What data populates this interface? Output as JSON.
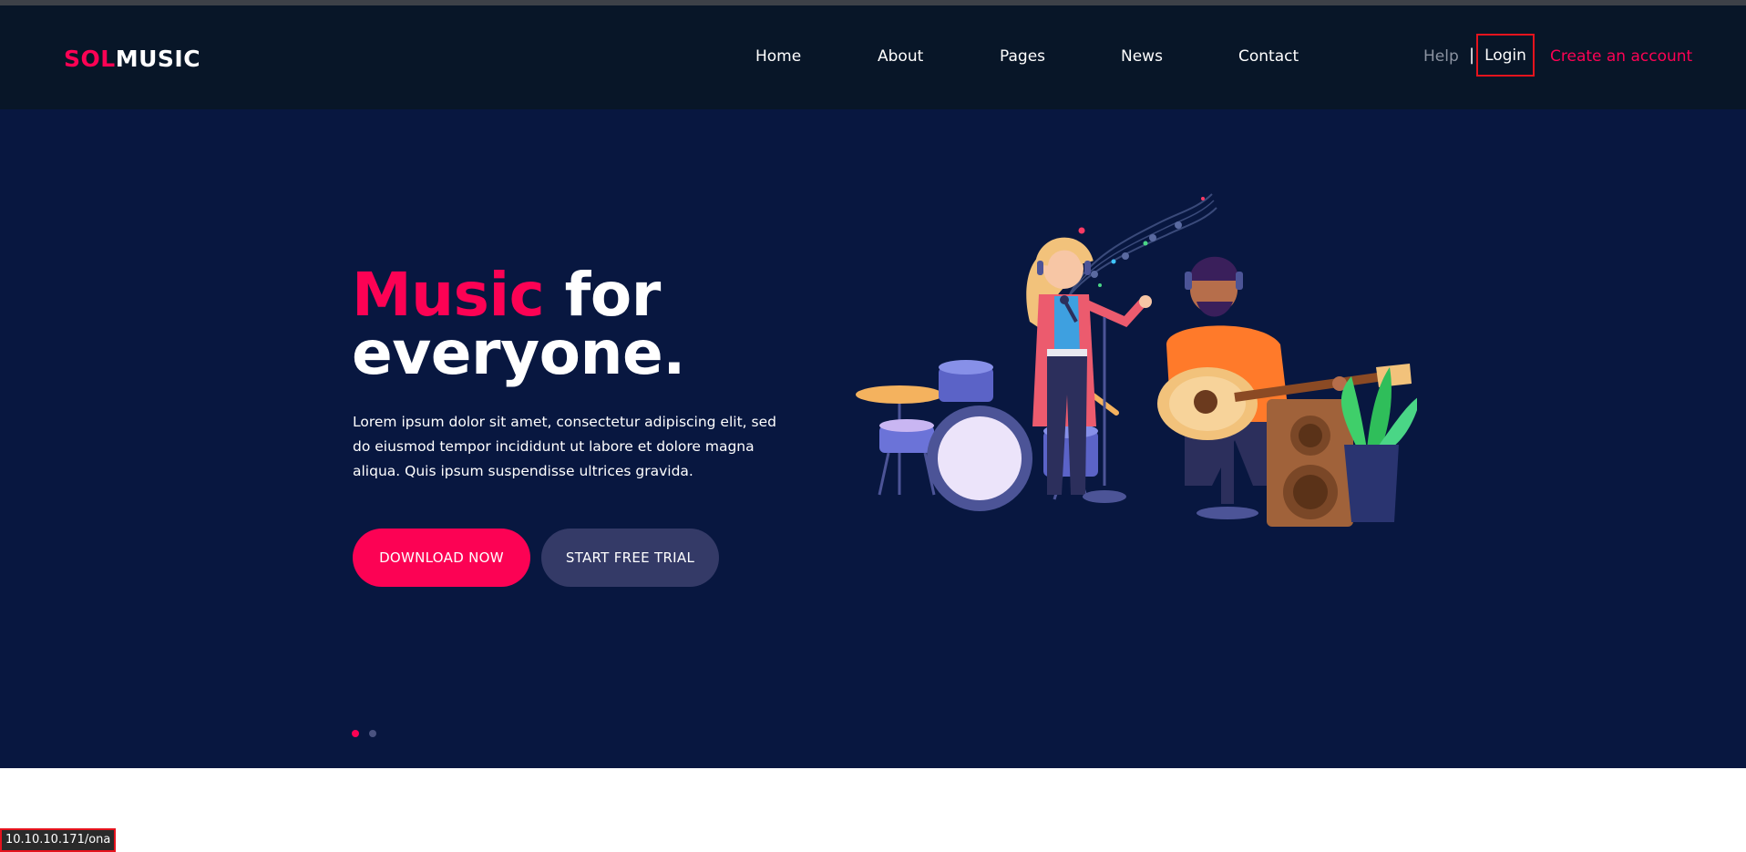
{
  "header": {
    "logo_primary": "SOL",
    "logo_secondary": "MUSIC",
    "nav": [
      {
        "label": "Home"
      },
      {
        "label": "About"
      },
      {
        "label": "Pages"
      },
      {
        "label": "News"
      },
      {
        "label": "Contact"
      }
    ],
    "help_label": "Help",
    "separator": "|",
    "login_label": "Login",
    "create_account_label": "Create an account"
  },
  "hero": {
    "headline_accent": "Music",
    "headline_rest_1": " for",
    "headline_rest_2": "everyone.",
    "lead": "Lorem ipsum dolor sit amet, consectetur adipiscing elit, sed do eiusmod tempor incididunt ut labore et dolore magna aliqua. Quis ipsum suspendisse ultrices gravida.",
    "download_label": "DOWNLOAD NOW",
    "trial_label": "START FREE TRIAL",
    "slides": 2,
    "active_slide": 1
  },
  "status_bar": {
    "url": "10.10.10.171/ona"
  },
  "colors": {
    "accent": "#fc0254",
    "header_bg": "#081628",
    "hero_bg": "#081740",
    "secondary_button": "#343a67",
    "highlight_box": "#e5131d"
  },
  "icons": [
    "music-notes-icon",
    "drum-kit-icon",
    "guitar-icon",
    "speaker-icon",
    "plant-icon"
  ]
}
